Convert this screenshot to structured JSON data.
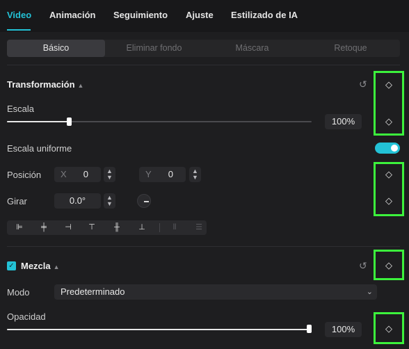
{
  "tabs": [
    {
      "label": "Video",
      "active": true
    },
    {
      "label": "Animación"
    },
    {
      "label": "Seguimiento"
    },
    {
      "label": "Ajuste"
    },
    {
      "label": "Estilizado de IA"
    }
  ],
  "subtabs": [
    {
      "label": "Básico",
      "active": true
    },
    {
      "label": "Eliminar fondo"
    },
    {
      "label": "Máscara"
    },
    {
      "label": "Retoque"
    }
  ],
  "transform": {
    "title": "Transformación",
    "reset_icon": "reset-icon",
    "scale_label": "Escala",
    "scale_value": "100%",
    "scale_fraction": 0.22,
    "uniform_label": "Escala uniforme",
    "uniform_on": true,
    "position_label": "Posición",
    "pos_x_letter": "X",
    "pos_x_value": "0",
    "pos_y_letter": "Y",
    "pos_y_value": "0",
    "rotate_label": "Girar",
    "rotate_value": "0.0°"
  },
  "align_icons": [
    "align-left-icon",
    "align-center-horizontal-icon",
    "align-right-icon",
    "align-top-icon",
    "align-center-vertical-icon",
    "align-bottom-icon",
    "distribute-horizontal-icon",
    "distribute-vertical-icon"
  ],
  "blend": {
    "title": "Mezcla",
    "enabled": true,
    "mode_label": "Modo",
    "mode_value": "Predeterminado",
    "opacity_label": "Opacidad",
    "opacity_value": "100%",
    "opacity_fraction": 1.0
  },
  "colors": {
    "accent": "#23c2d6",
    "keyframe_highlight": "#3cf23c"
  }
}
